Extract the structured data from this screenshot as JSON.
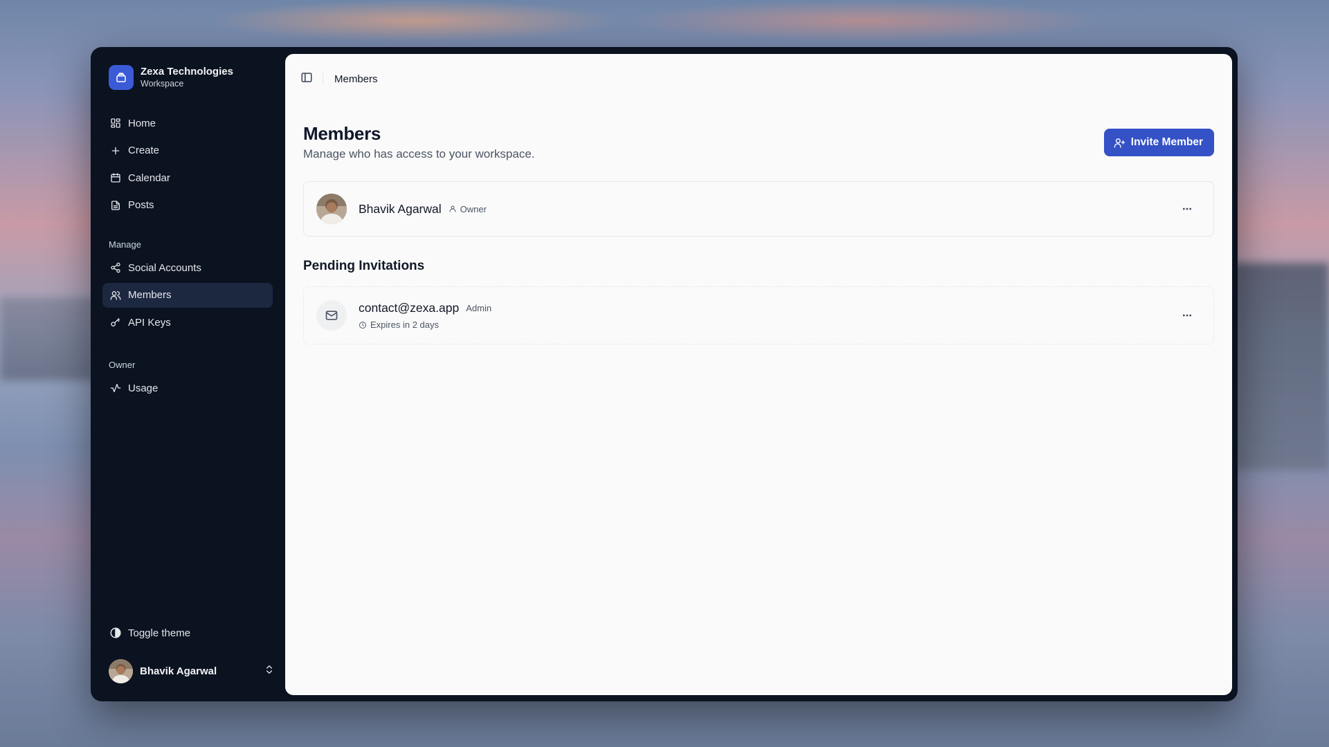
{
  "workspace": {
    "name": "Zexa Technologies",
    "subtitle": "Workspace"
  },
  "nav": {
    "main": [
      {
        "label": "Home",
        "icon": "layout-grid-icon"
      },
      {
        "label": "Create",
        "icon": "plus-icon"
      },
      {
        "label": "Calendar",
        "icon": "calendar-icon"
      },
      {
        "label": "Posts",
        "icon": "file-text-icon"
      }
    ],
    "manage_label": "Manage",
    "manage": [
      {
        "label": "Social Accounts",
        "icon": "share-icon"
      },
      {
        "label": "Members",
        "icon": "users-icon",
        "active": true
      },
      {
        "label": "API Keys",
        "icon": "key-icon"
      }
    ],
    "owner_label": "Owner",
    "owner": [
      {
        "label": "Usage",
        "icon": "activity-icon"
      }
    ]
  },
  "footer": {
    "toggle_theme": "Toggle theme",
    "user_name": "Bhavik Agarwal"
  },
  "breadcrumb": {
    "current": "Members"
  },
  "page": {
    "title": "Members",
    "subtitle": "Manage who has access to your workspace.",
    "invite_button": "Invite Member"
  },
  "members": [
    {
      "name": "Bhavik Agarwal",
      "role": "Owner"
    }
  ],
  "pending": {
    "title": "Pending Invitations",
    "items": [
      {
        "email": "contact@zexa.app",
        "role": "Admin",
        "expires": "Expires in 2 days"
      }
    ]
  },
  "colors": {
    "accent": "#3451c6",
    "sidebar_bg": "#0b1220",
    "active_item": "#1c2740"
  }
}
